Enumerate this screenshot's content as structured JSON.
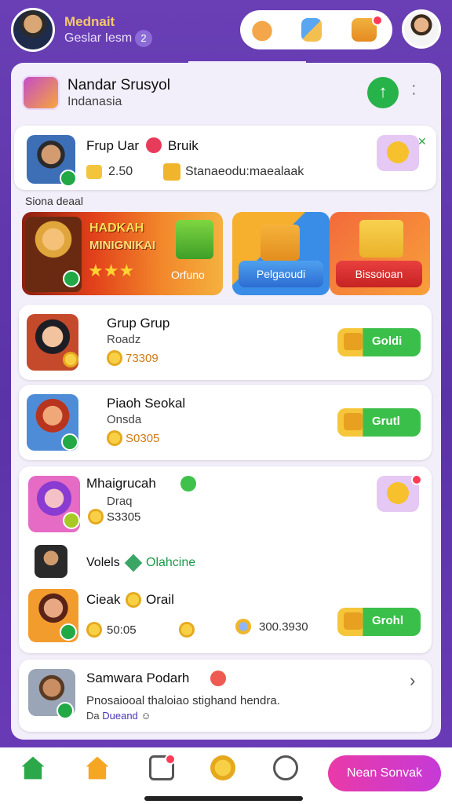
{
  "topbar": {
    "user_name": "Mednait",
    "user_sub": "Geslar Iesm",
    "count": "2"
  },
  "header": {
    "title": "Nandar Srusyol",
    "subtitle": "Indanasia"
  },
  "profile_card": {
    "title": "Frup Uar",
    "title2": "Bruik",
    "value": "2.50",
    "text": "Stanaeodu:maealaak"
  },
  "section_label": "Siona deaal",
  "banners": {
    "main": {
      "line1": "HADKAH",
      "line2": "MINIGNIKAI",
      "caption": "Orfuno"
    },
    "b": {
      "button": "Pelgaoudi"
    },
    "c": {
      "button": "Bissoioan"
    }
  },
  "games": [
    {
      "title": "Grup Grup",
      "subtitle": "Roadz",
      "value": "73309",
      "button": "Goldi"
    },
    {
      "title": "Piaoh Seokal",
      "subtitle": "Onsda",
      "value": "S0305",
      "button": "Grutl"
    }
  ],
  "big_card": {
    "title": "Mhaigrucah",
    "subtitle": "Draq",
    "value": "S3305",
    "volume_label": "Volels",
    "volume_value": "Olahcine",
    "check_title": "Cieak",
    "check_title2": "Orail",
    "check_value": "50:05",
    "check_score": "300.3930",
    "button": "Grohl"
  },
  "last_card": {
    "title": "Samwara Podarh",
    "description": "Pnosaiooal thaloiao stighand hendra.",
    "meta_prefix": "Da",
    "meta_link": "Dueand"
  },
  "tabbar": {
    "cta": "Nean Sonvak"
  },
  "colors": {
    "background": "#6a3fb5",
    "accent_green": "#2ca84b",
    "cta_pink": "#e93aa8"
  }
}
